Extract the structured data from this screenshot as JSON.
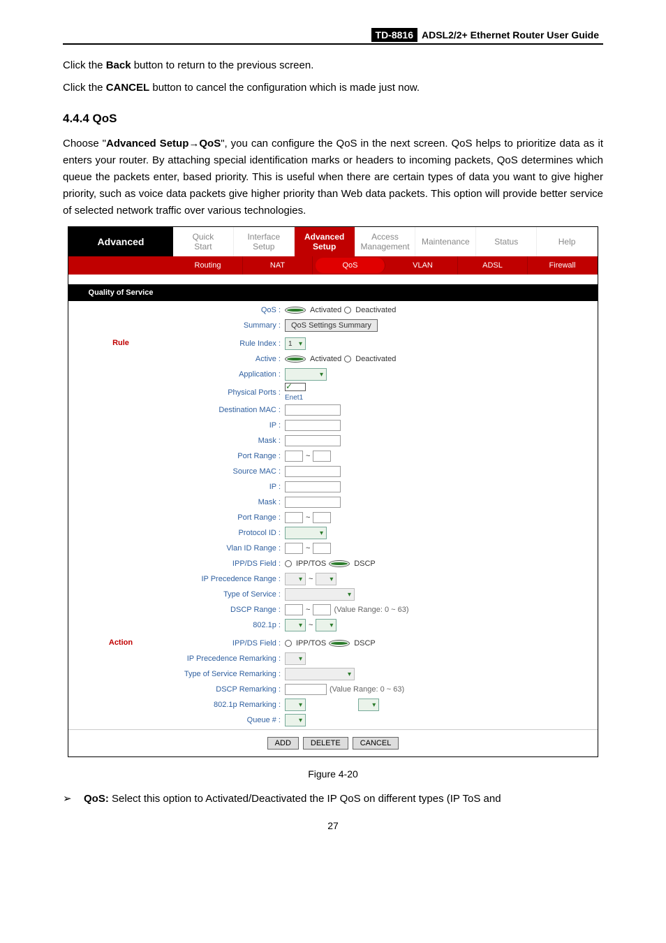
{
  "header": {
    "model": "TD-8816",
    "desc": "ADSL2/2+ Ethernet Router User Guide"
  },
  "body": {
    "p1_a": "Click the ",
    "p1_b": "Back",
    "p1_c": " button to return to the previous screen.",
    "p2_a": "Click the ",
    "p2_b": "CANCEL",
    "p2_c": " button to cancel the configuration which is made just now.",
    "section": "4.4.4  QoS",
    "p3_a": "Choose \"",
    "p3_b": "Advanced Setup",
    "p3_c": "→",
    "p3_d": "QoS",
    "p3_e": "\", you can configure the QoS in the next screen. QoS helps to prioritize data as it enters your router. By attaching special identification marks or headers to incoming packets, QoS determines which queue the packets enter, based priority. This is useful when there are certain types of data you want to give higher priority, such as voice data packets give higher priority than Web data packets. This option will provide better service of selected network traffic over various technologies."
  },
  "ui": {
    "leftLabel": "Advanced",
    "tabs": {
      "quick": "Quick\nStart",
      "interface": "Interface\nSetup",
      "advanced": "Advanced\nSetup",
      "access": "Access\nManagement",
      "maint": "Maintenance",
      "status": "Status",
      "help": "Help"
    },
    "subtabs": {
      "routing": "Routing",
      "nat": "NAT",
      "qos": "QoS",
      "vlan": "VLAN",
      "adsl": "ADSL",
      "firewall": "Firewall"
    },
    "qosSection": "Quality of Service",
    "qos": {
      "label": "QoS :",
      "opt1": "Activated",
      "opt2": "Deactivated",
      "summaryLabel": "Summary :",
      "summaryBtn": "QoS Settings Summary"
    },
    "ruleSide": "Rule",
    "rule": {
      "ruleIndexLabel": "Rule Index :",
      "ruleIndexVal": "1",
      "activeLabel": "Active :",
      "activeOpt1": "Activated",
      "activeOpt2": "Deactivated",
      "appLabel": "Application :",
      "physLabel": "Physical Ports :",
      "physPort": "Enet1",
      "destMacLabel": "Destination MAC :",
      "ipLabel": "IP :",
      "maskLabel": "Mask :",
      "portRangeLabel": "Port Range :",
      "srcMacLabel": "Source MAC :",
      "ip2Label": "IP :",
      "mask2Label": "Mask :",
      "portRange2Label": "Port Range :",
      "protoLabel": "Protocol ID :",
      "vlanLabel": "Vlan ID Range :",
      "ippdsLabel": "IPP/DS Field :",
      "ippdsOpt1": "IPP/TOS",
      "ippdsOpt2": "DSCP",
      "ipPrecLabel": "IP Precedence Range :",
      "tosLabel": "Type of Service :",
      "dscpLabel": "DSCP Range :",
      "dscpHint": "(Value Range: 0 ~ 63)",
      "p8021Label": "802.1p :"
    },
    "actionSide": "Action",
    "action": {
      "ippdsLabel": "IPP/DS Field :",
      "ippdsOpt1": "IPP/TOS",
      "ippdsOpt2": "DSCP",
      "ipPrecRemLabel": "IP Precedence Remarking :",
      "tosRemLabel": "Type of Service Remarking :",
      "dscpRemLabel": "DSCP Remarking :",
      "dscpRemHint": "(Value Range: 0 ~ 63)",
      "p8021RemLabel": "802.1p Remarking :",
      "queueLabel": "Queue # :"
    },
    "buttons": {
      "add": "ADD",
      "delete": "DELETE",
      "cancel": "CANCEL"
    }
  },
  "figcap": "Figure 4-20",
  "bullet": {
    "mark": "➢",
    "lead": "QoS:",
    "text": " Select this option to Activated/Deactivated the IP QoS on different types (IP ToS and"
  },
  "pagenum": "27"
}
